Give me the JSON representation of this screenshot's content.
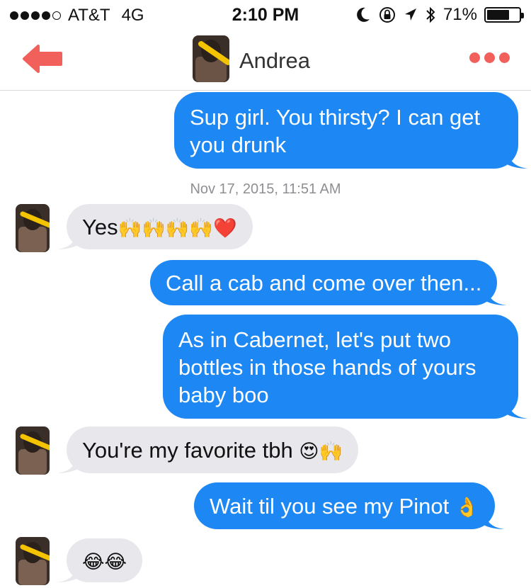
{
  "status_bar": {
    "carrier": "AT&T",
    "network": "4G",
    "time": "2:10 PM",
    "battery": "71%",
    "battery_level": 0.71,
    "signal_bars": 4
  },
  "header": {
    "contact_name": "Andrea",
    "back_icon": "back-arrow-icon",
    "more_icon": "more-dots-icon",
    "accent_color": "#f2605b"
  },
  "conversation": {
    "timestamp": "Nov 17, 2015, 11:51 AM",
    "messages": [
      {
        "direction": "outgoing",
        "text": "Sup girl. You thirsty? I can get you drunk"
      },
      {
        "direction": "incoming",
        "text": "Yes",
        "emoji": "🙌🙌🙌🙌❤️"
      },
      {
        "direction": "outgoing",
        "text": "Call a cab and come over then..."
      },
      {
        "direction": "outgoing",
        "text": "As in Cabernet, let's put two bottles in those hands of yours baby boo"
      },
      {
        "direction": "incoming",
        "text": "You're my favorite tbh",
        "emoji": "😍🙌"
      },
      {
        "direction": "outgoing",
        "text": "Wait til you see my Pinot",
        "emoji": "👌"
      },
      {
        "direction": "incoming",
        "text": "",
        "emoji": "😂😂"
      }
    ]
  },
  "colors": {
    "outgoing_bubble": "#1d87f3",
    "incoming_bubble": "#e8e8ec",
    "timestamp_text": "#8e8e93"
  }
}
